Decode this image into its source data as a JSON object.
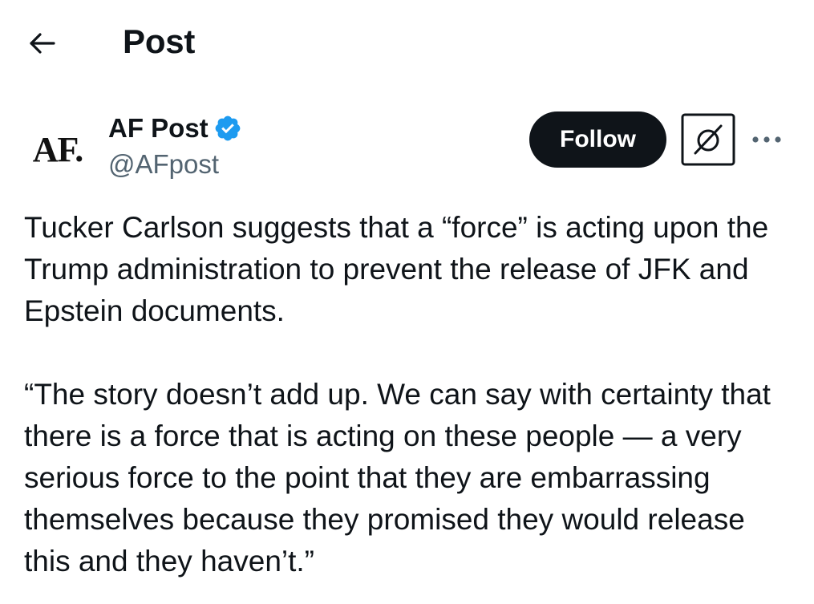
{
  "header": {
    "back_icon": "arrow-left-icon",
    "title": "Post"
  },
  "author": {
    "avatar_text": "AF.",
    "display_name": "AF Post",
    "verified_icon": "verified-badge-icon",
    "verified_color": "#1d9bf0",
    "handle": "@AFpost"
  },
  "actions": {
    "follow_label": "Follow",
    "grok_icon": "grok-icon",
    "more_icon": "more-horizontal-icon"
  },
  "post": {
    "paragraphs": [
      "Tucker Carlson suggests that a “force” is acting upon the Trump administration to prevent the release of JFK and Epstein documents.",
      "“The story doesn’t add up. We can say with certainty that there is a force that is acting on these people — a very serious force to the point that they are embarrassing themselves because they promised they would release this and they haven’t.”"
    ]
  },
  "colors": {
    "text": "#0f1419",
    "secondary_text": "#536471",
    "button_bg": "#0f1419",
    "button_text": "#ffffff",
    "accent": "#1d9bf0"
  }
}
